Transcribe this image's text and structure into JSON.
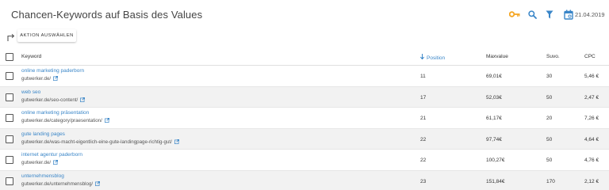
{
  "header": {
    "title": "Chancen-Keywords auf Basis des Values",
    "date": "21.04.2019",
    "accent_color": "#f5a623",
    "icon_blue": "#3a86c8"
  },
  "actions": {
    "action_button_label": "AKTION AUSWÄHLEN"
  },
  "table": {
    "columns": {
      "keyword": "Keyword",
      "position": "Position",
      "maxvalue": "Maxvalue",
      "suvo": "Suvo.",
      "cpc": "CPC"
    },
    "rows": [
      {
        "keyword": "online marketing paderborn",
        "url": "gutwerker.de/",
        "position": "11",
        "maxvalue": "69,01€",
        "suvo": "30",
        "cpc": "5,46 €"
      },
      {
        "keyword": "web seo",
        "url": "gutwerker.de/seo-content/",
        "position": "17",
        "maxvalue": "52,03€",
        "suvo": "50",
        "cpc": "2,47 €"
      },
      {
        "keyword": "online marketing präsentation",
        "url": "gutwerker.de/category/praesentation/",
        "position": "21",
        "maxvalue": "61,17€",
        "suvo": "20",
        "cpc": "7,26 €"
      },
      {
        "keyword": "gute landing pages",
        "url": "gutwerker.de/was-macht-eigentlich-eine-gute-landingpage-richtig-gut/",
        "position": "22",
        "maxvalue": "97,74€",
        "suvo": "50",
        "cpc": "4,64 €"
      },
      {
        "keyword": "internet agentur paderborn",
        "url": "gutwerker.de/",
        "position": "22",
        "maxvalue": "100,27€",
        "suvo": "50",
        "cpc": "4,76 €"
      },
      {
        "keyword": "unternehmensblog",
        "url": "gutwerker.de/unternehmensblog/",
        "position": "23",
        "maxvalue": "151,84€",
        "suvo": "170",
        "cpc": "2,12 €"
      }
    ]
  }
}
